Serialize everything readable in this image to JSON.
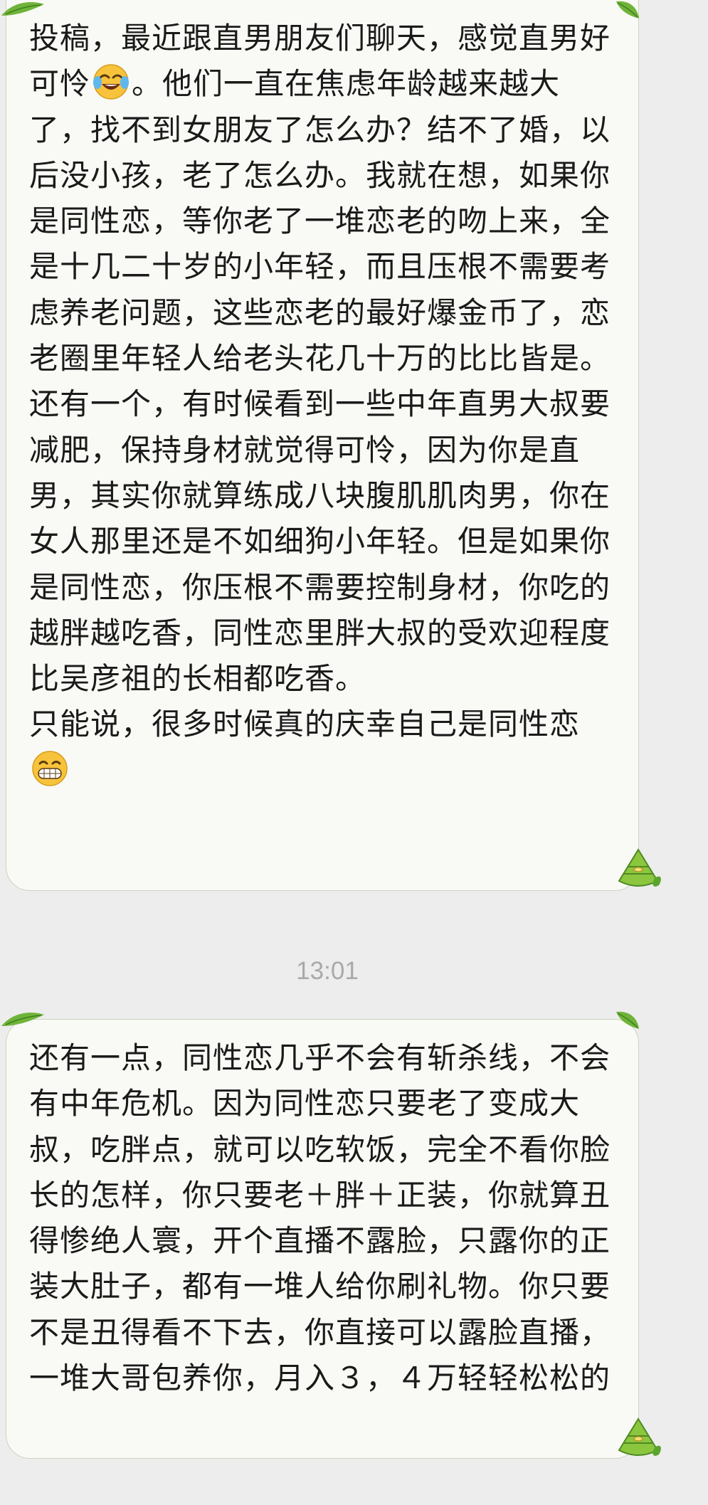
{
  "messages": [
    {
      "paragraphs": [
        {
          "text_before_emoji": "投稿，最近跟直男朋友们聊天，感觉直男好可怜",
          "emoji": "face-with-tears-of-joy",
          "text_after_emoji": "。他们一直在焦虑年龄越来越大了，找不到女朋友了怎么办？结不了婚，以后没小孩，老了怎么办。我就在想，如果你是同性恋，等你老了一堆恋老的吻上来，全是十几二十岁的小年轻，而且压根不需要考虑养老问题，这些恋老的最好爆金币了，恋老圈里年轻人给老头花几十万的比比皆是。"
        },
        {
          "text": "还有一个，有时候看到一些中年直男大叔要减肥，保持身材就觉得可怜，因为你是直男，其实你就算练成八块腹肌肌肉男，你在女人那里还是不如细狗小年轻。但是如果你是同性恋，你压根不需要控制身材，你吃的越胖越吃香，同性恋里胖大叔的受欢迎程度比吴彦祖的长相都吃香。"
        },
        {
          "text_before_emoji": "只能说，很多时候真的庆幸自己是同性恋",
          "emoji": "grinning-face"
        }
      ]
    },
    {
      "paragraphs": [
        {
          "text": "还有一点，同性恋几乎不会有斩杀线，不会有中年危机。因为同性恋只要老了变成大叔，吃胖点，就可以吃软饭，完全不看你脸长的怎样，你只要老＋胖＋正装，你就算丑得惨绝人寰，开个直播不露脸，只露你的正装大肚子，都有一堆人给你刷礼物。你只要不是丑得看不下去，你直接可以露脸直播，一堆大哥包养你，月入３，４万轻轻松松的"
        }
      ]
    }
  ],
  "timestamp": "13:01",
  "icons": [
    "leaf-icon",
    "zongzi-icon"
  ],
  "colors": {
    "bubble_bg": "#f9faf5",
    "bubble_border": "#c9d6bd",
    "leaf": "#6fb43a",
    "zongzi": "#8cc63f"
  }
}
